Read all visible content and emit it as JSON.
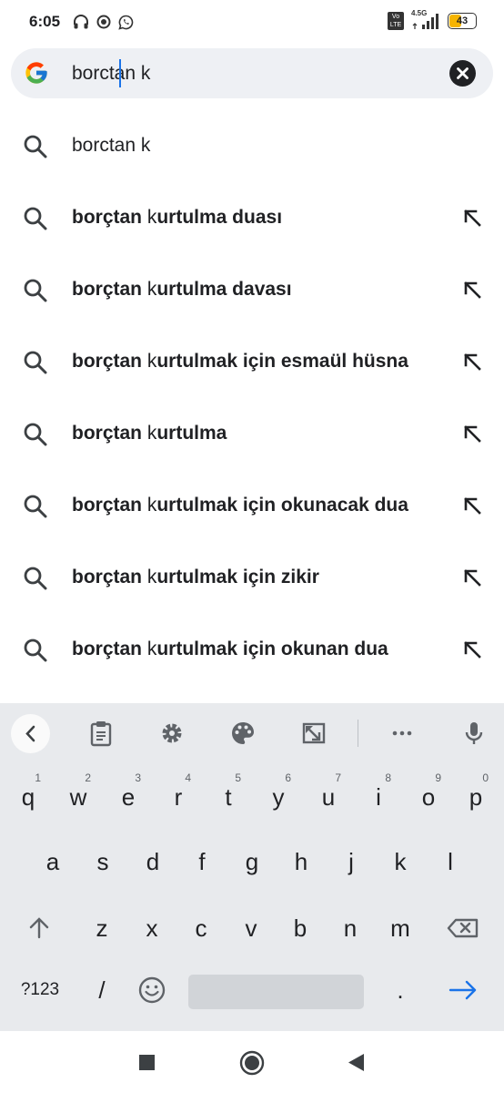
{
  "status_bar": {
    "time": "6:05",
    "network": "4.5G",
    "volte": "Vo LTE",
    "battery": "43"
  },
  "search": {
    "query": "borctan k",
    "logo": "google-g-logo",
    "clear_icon": "close-icon"
  },
  "suggestions": [
    {
      "text": "borctan k",
      "style": "plain",
      "fill_icon": false
    },
    {
      "prefix": "borçtan ",
      "typed": "k",
      "rest": "urtulma duası",
      "fill_icon": true
    },
    {
      "prefix": "borçtan ",
      "typed": "k",
      "rest": "urtulma davası",
      "fill_icon": true
    },
    {
      "prefix": "borçtan ",
      "typed": "k",
      "rest": "urtulmak için esmaül hüsna",
      "fill_icon": true
    },
    {
      "prefix": "borçtan ",
      "typed": "k",
      "rest": "urtulma",
      "fill_icon": true
    },
    {
      "prefix": "borçtan ",
      "typed": "k",
      "rest": "urtulmak için okunacak dua",
      "fill_icon": true
    },
    {
      "prefix": "borçtan ",
      "typed": "k",
      "rest": "urtulmak için zikir",
      "fill_icon": true
    },
    {
      "prefix": "borçtan ",
      "typed": "k",
      "rest": "urtulmak için okunan dua",
      "fill_icon": true
    }
  ],
  "keyboard": {
    "toolbar_icons": [
      "back-chevron-icon",
      "clipboard-icon",
      "settings-icon",
      "palette-icon",
      "resize-icon",
      "more-icon",
      "microphone-icon"
    ],
    "row1": [
      {
        "k": "q",
        "n": "1"
      },
      {
        "k": "w",
        "n": "2"
      },
      {
        "k": "e",
        "n": "3"
      },
      {
        "k": "r",
        "n": "4"
      },
      {
        "k": "t",
        "n": "5"
      },
      {
        "k": "y",
        "n": "6"
      },
      {
        "k": "u",
        "n": "7"
      },
      {
        "k": "i",
        "n": "8"
      },
      {
        "k": "o",
        "n": "9"
      },
      {
        "k": "p",
        "n": "0"
      }
    ],
    "row2": [
      "a",
      "s",
      "d",
      "f",
      "g",
      "h",
      "j",
      "k",
      "l"
    ],
    "row3": [
      "z",
      "x",
      "c",
      "v",
      "b",
      "n",
      "m"
    ],
    "symbols_key": "?123",
    "slash_key": "/",
    "period_key": ".",
    "shift_icon": "shift-arrow-icon",
    "backspace_icon": "backspace-icon",
    "emoji_icon": "emoji-icon",
    "enter_icon": "enter-arrow-icon",
    "enter_color": "#1a73e8"
  },
  "nav_bar": {
    "icons": [
      "recents-square-icon",
      "home-circle-icon",
      "back-triangle-icon"
    ]
  }
}
